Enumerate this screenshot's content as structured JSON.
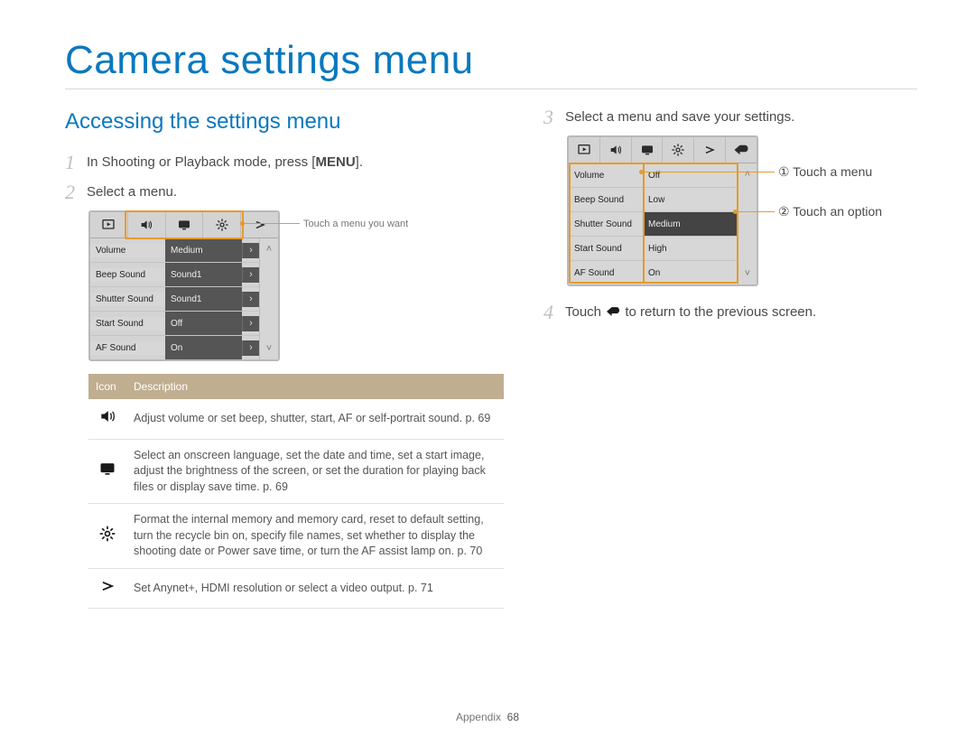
{
  "title": "Camera settings menu",
  "subtitle": "Accessing the settings menu",
  "footer": {
    "section": "Appendix",
    "page": "68"
  },
  "left": {
    "step1_pre": "In Shooting or Playback mode, press [",
    "step1_bold": "MENU",
    "step1_post": "].",
    "step2": "Select a menu.",
    "callout_tabs": "Touch a menu you want",
    "screen": {
      "rows": [
        {
          "label": "Volume",
          "value": "Medium"
        },
        {
          "label": "Beep Sound",
          "value": "Sound1"
        },
        {
          "label": "Shutter Sound",
          "value": "Sound1"
        },
        {
          "label": "Start Sound",
          "value": "Off"
        },
        {
          "label": "AF Sound",
          "value": "On"
        }
      ]
    },
    "table": {
      "headers": {
        "icon": "Icon",
        "desc": "Description"
      },
      "rows": [
        {
          "desc": "Adjust volume or set beep, shutter, start, AF or self-portrait sound. p. 69"
        },
        {
          "desc": "Select an onscreen language, set the date and time, set a start image, adjust the brightness of the screen, or set the duration for playing back files or display save time. p. 69"
        },
        {
          "desc": "Format the internal memory and memory card, reset to default setting, turn the recycle bin on, specify file names, set whether to display the shooting date or Power save time, or turn the AF assist lamp on. p. 70"
        },
        {
          "desc": "Set Anynet+, HDMI resolution or select a video output. p. 71"
        }
      ]
    }
  },
  "right": {
    "step3": "Select a menu and save your settings.",
    "step4_pre": "Touch ",
    "step4_post": " to return to the previous screen.",
    "callout_menu": "Touch a menu",
    "callout_option": "Touch an option",
    "circ1": "①",
    "circ2": "②",
    "screen": {
      "labels": [
        "Volume",
        "Beep Sound",
        "Shutter Sound",
        "Start Sound",
        "AF Sound"
      ],
      "options": [
        "Off",
        "Low",
        "Medium",
        "High",
        "On"
      ],
      "selected": "Medium"
    }
  }
}
